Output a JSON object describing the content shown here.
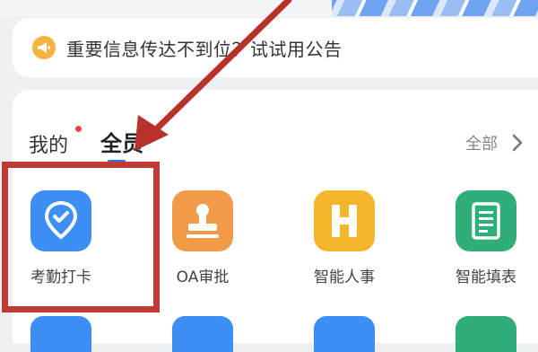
{
  "notice": {
    "text": "重要信息传达不到位？试试用公告",
    "icon": "megaphone-icon",
    "icon_color": "#f3b33d"
  },
  "tabs": {
    "mine": "我的",
    "all_staff": "全员",
    "active": "all_staff",
    "mine_has_unread_dot": true
  },
  "all_link": {
    "label": "全部",
    "icon": "chevron-right-icon"
  },
  "apps": [
    {
      "label": "考勤打卡",
      "icon": "location-check-icon",
      "color": "#3d8ef5"
    },
    {
      "label": "OA审批",
      "icon": "stamp-icon",
      "color": "#f19a47"
    },
    {
      "label": "智能人事",
      "icon": "h-badge-icon",
      "color": "#f4b72b"
    },
    {
      "label": "智能填表",
      "icon": "form-sheet-icon",
      "color": "#2fae78"
    }
  ],
  "row2_colors": [
    "#3d8ef5",
    "#3d8ef5",
    "#3d8ef5",
    "#2fae78"
  ],
  "annotation": {
    "box_color": "#c23a35",
    "arrow_color": "#b8322c",
    "highlighted_app": "考勤打卡"
  }
}
